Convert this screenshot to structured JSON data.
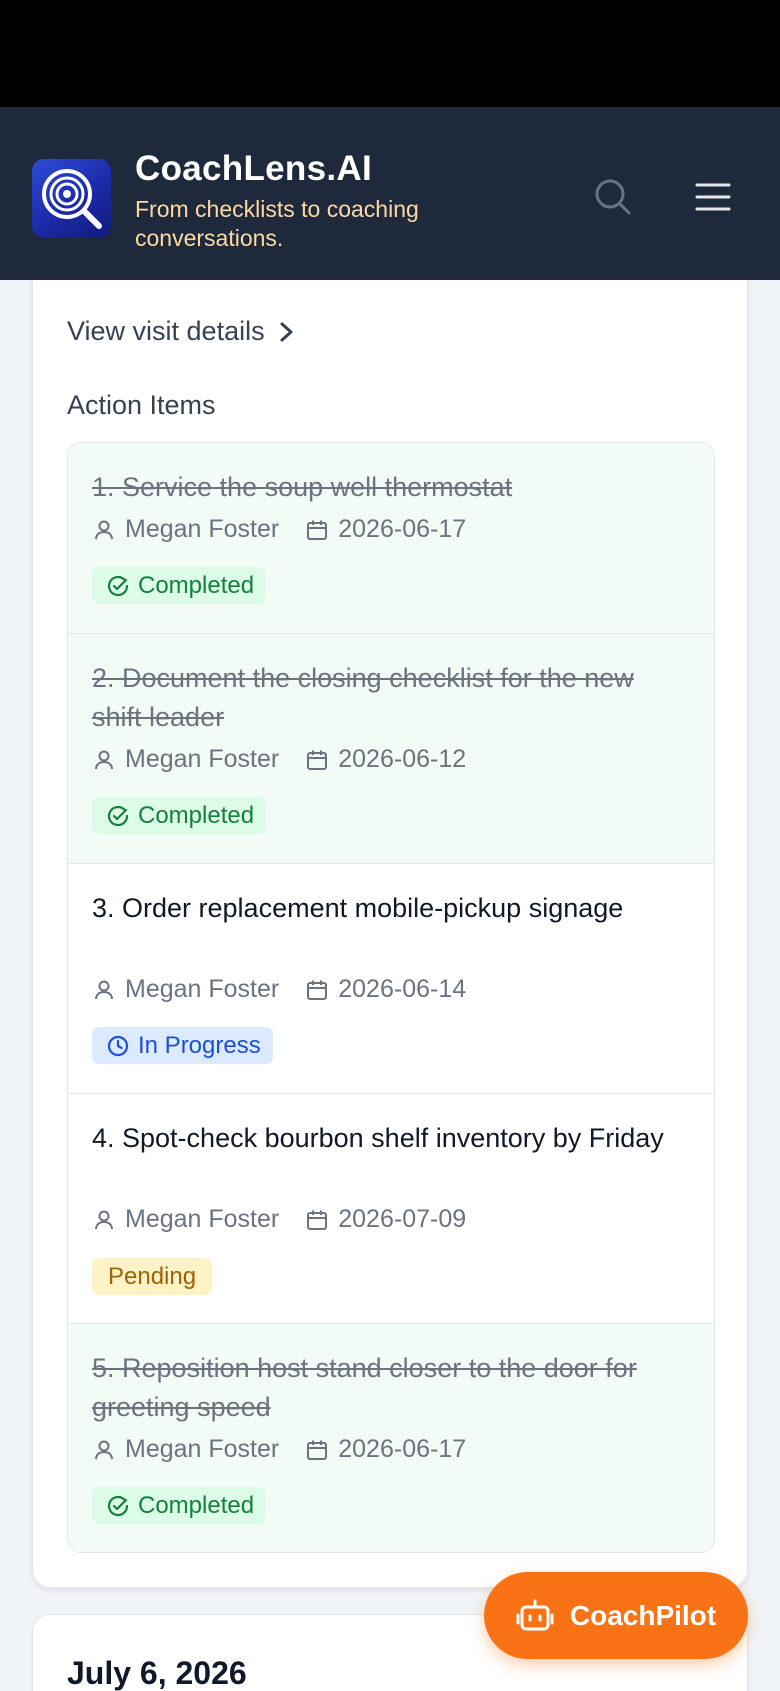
{
  "header": {
    "title": "CoachLens.AI",
    "tagline": "From checklists to coaching conversations."
  },
  "visit": {
    "view_details_label": "View visit details",
    "action_items_title": "Action Items",
    "items": [
      {
        "title": "1. Service the soup well thermostat",
        "assignee": "Megan Foster",
        "due": "2026-06-17",
        "status": "Completed"
      },
      {
        "title": "2. Document the closing checklist for the new shift leader",
        "assignee": "Megan Foster",
        "due": "2026-06-12",
        "status": "Completed"
      },
      {
        "title": "3. Order replacement mobile-pickup signage",
        "assignee": "Megan Foster",
        "due": "2026-06-14",
        "status": "In Progress"
      },
      {
        "title": "4. Spot-check bourbon shelf inventory by Friday",
        "assignee": "Megan Foster",
        "due": "2026-07-09",
        "status": "Pending"
      },
      {
        "title": "5. Reposition host stand closer to the door for greeting speed",
        "assignee": "Megan Foster",
        "due": "2026-06-17",
        "status": "Completed"
      }
    ]
  },
  "next_visit": {
    "date": "July 6, 2026"
  },
  "fab": {
    "label": "CoachPilot"
  },
  "colors": {
    "header_bg": "#1e293b",
    "tagline": "#fcd9a5",
    "accent_orange": "#f97316",
    "completed": "#15803d",
    "in_progress": "#1d4ed8",
    "pending": "#a16207"
  },
  "icons": {
    "logo": "target-magnifier-icon",
    "search": "search-icon",
    "menu": "hamburger-menu-icon",
    "chevron": "chevron-right-icon",
    "assignee": "user-icon",
    "due": "calendar-icon",
    "completed": "check-circle-icon",
    "in_progress": "clock-icon",
    "fab": "robot-icon"
  }
}
